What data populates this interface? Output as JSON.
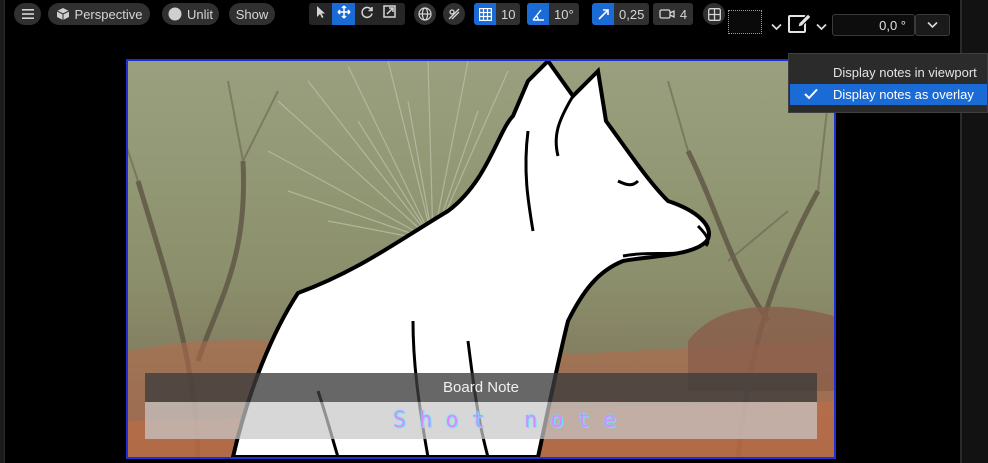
{
  "toolbar": {
    "perspective_label": "Perspective",
    "lit_mode_label": "Unlit",
    "show_label": "Show",
    "grid_snap_value": "10",
    "rotation_snap_value": "10°",
    "scale_snap_value": "0,25",
    "camera_speed_value": "4",
    "angle_field_value": "0,0 °"
  },
  "notes": {
    "board_note_label": "Board Note",
    "shot_note_label": "Shot note"
  },
  "dropdown": {
    "items": [
      {
        "label": "Display notes in viewport",
        "checked": false
      },
      {
        "label": "Display notes as overlay",
        "checked": true
      }
    ]
  },
  "colors": {
    "accent": "#1a6bd6",
    "viewport_border": "#1f2fd8"
  }
}
